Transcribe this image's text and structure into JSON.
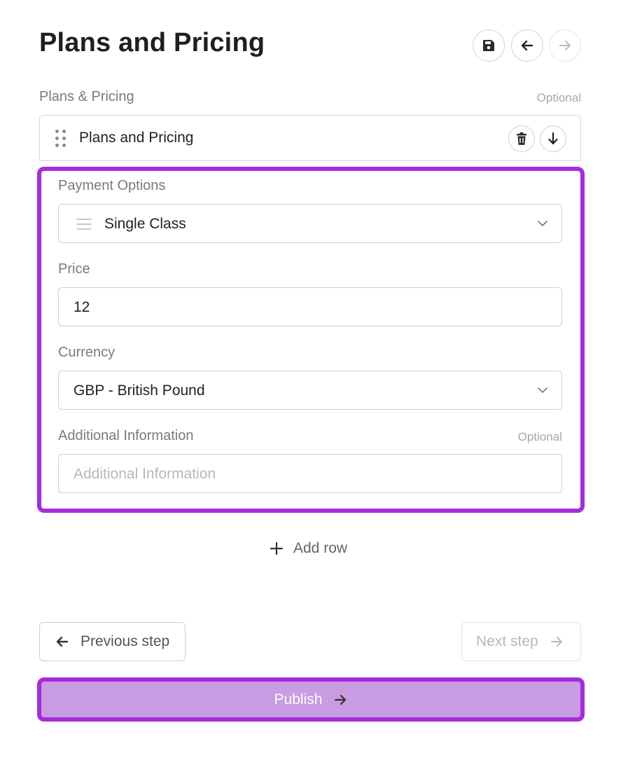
{
  "header": {
    "title": "Plans and Pricing",
    "save_icon": "save-icon",
    "back_icon": "arrow-left-icon",
    "forward_icon": "arrow-right-icon"
  },
  "section": {
    "label": "Plans & Pricing",
    "optional_label": "Optional"
  },
  "row": {
    "title": "Plans and Pricing",
    "delete_icon": "trash-icon",
    "move_down_icon": "arrow-down-icon"
  },
  "form": {
    "payment_options": {
      "label": "Payment Options",
      "value": "Single Class"
    },
    "price": {
      "label": "Price",
      "value": "12"
    },
    "currency": {
      "label": "Currency",
      "value": "GBP - British Pound"
    },
    "additional_info": {
      "label": "Additional Information",
      "optional_label": "Optional",
      "placeholder": "Additional Information"
    }
  },
  "add_row": {
    "label": "Add row"
  },
  "footer": {
    "previous_label": "Previous step",
    "next_label": "Next step",
    "publish_label": "Publish"
  },
  "colors": {
    "highlight": "#a62cdb",
    "publish_bg": "#c89be3"
  }
}
